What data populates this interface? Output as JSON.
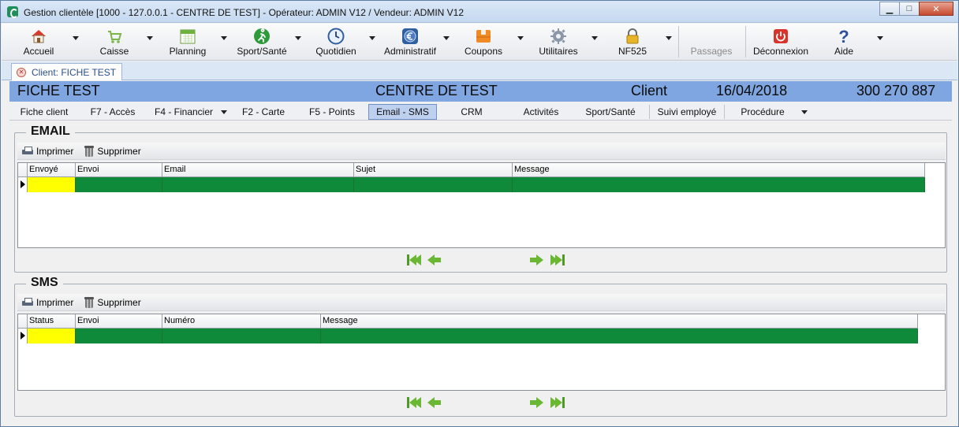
{
  "window": {
    "title": "Gestion clientèle [1000 - 127.0.0.1 - CENTRE DE TEST] - Opérateur: ADMIN V12 / Vendeur: ADMIN V12",
    "minimize": "▁",
    "maximize": "□",
    "close": "✕"
  },
  "toolbar": {
    "items": [
      {
        "label": "Accueil",
        "icon": "home-icon"
      },
      {
        "label": "Caisse",
        "icon": "cart-icon"
      },
      {
        "label": "Planning",
        "icon": "calendar-icon"
      },
      {
        "label": "Sport/Santé",
        "icon": "runner-icon"
      },
      {
        "label": "Quotidien",
        "icon": "clock-icon"
      },
      {
        "label": "Administratif",
        "icon": "euro-icon"
      },
      {
        "label": "Coupons",
        "icon": "coupon-icon"
      },
      {
        "label": "Utilitaires",
        "icon": "gear-icon"
      },
      {
        "label": "NF525",
        "icon": "lock-icon"
      },
      {
        "label": "Passages",
        "icon": ""
      },
      {
        "label": "Déconnexion",
        "icon": "power-icon"
      },
      {
        "label": "Aide",
        "icon": "help-icon"
      }
    ]
  },
  "doc_tab": {
    "label": "Client: FICHE TEST"
  },
  "banner": {
    "name": "FICHE TEST",
    "center": "CENTRE DE TEST",
    "type": "Client",
    "date": "16/04/2018",
    "phone": "300 270 887"
  },
  "subtabs": [
    "Fiche client",
    "F7 - Accès",
    "F4 - Financier",
    "F2 - Carte",
    "F5 - Points",
    "Email - SMS",
    "CRM",
    "Activités",
    "Sport/Santé",
    "Suivi employé",
    "Procédure"
  ],
  "email": {
    "title": "EMAIL",
    "print_label": "Imprimer",
    "delete_label": "Supprimer",
    "columns": [
      "Envoyé",
      "Envoi",
      "Email",
      "Sujet",
      "Message"
    ]
  },
  "sms": {
    "title": "SMS",
    "print_label": "Imprimer",
    "delete_label": "Supprimer",
    "columns": [
      "Status",
      "Envoi",
      "Numéro",
      "Message"
    ]
  },
  "colors": {
    "banner": "#7fa6e0",
    "row_green": "#0e8a3a",
    "row_yellow": "#ffff00",
    "active_tab": "#bdd0ee"
  }
}
